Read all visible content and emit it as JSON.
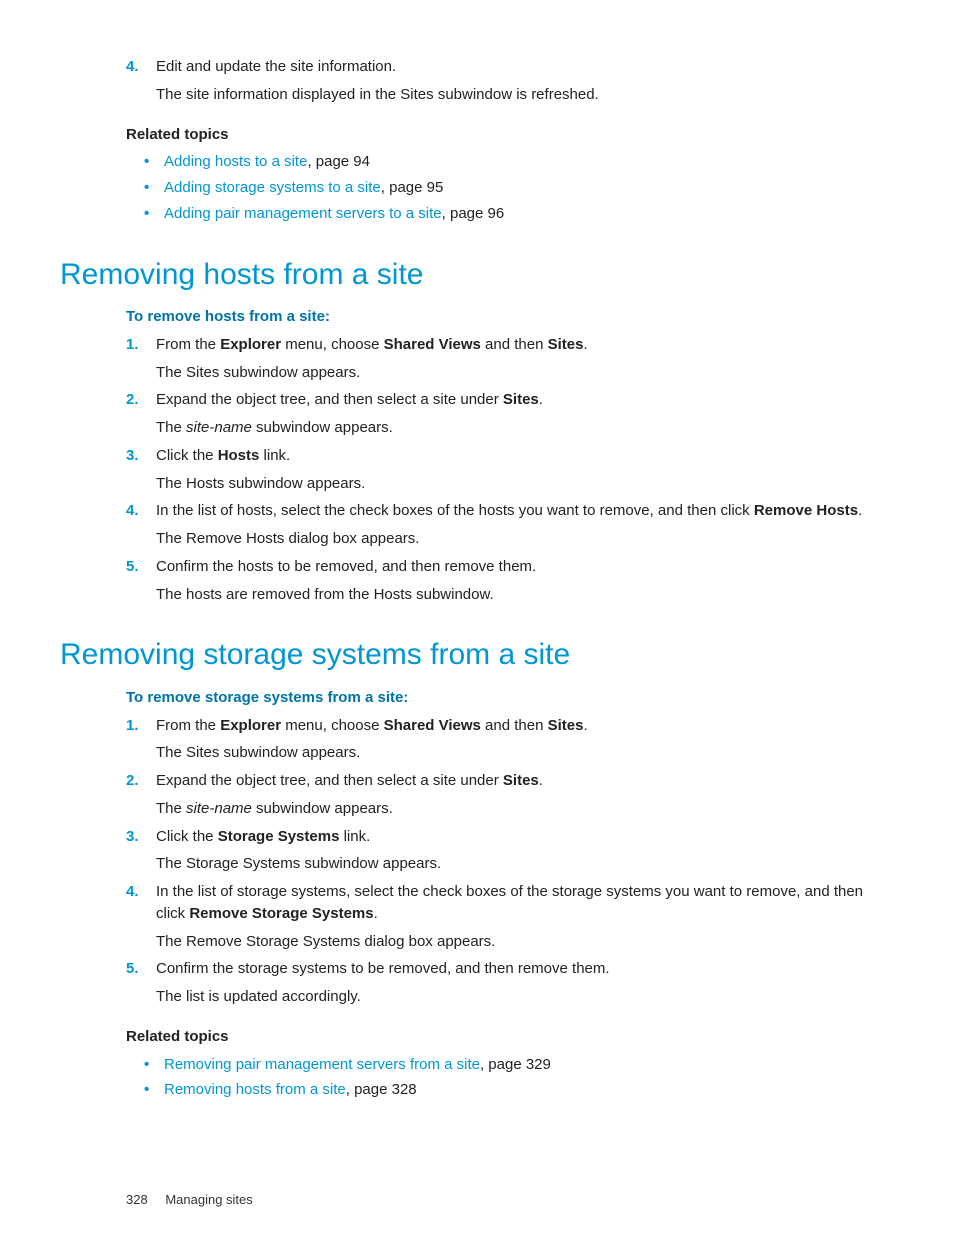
{
  "top": {
    "step4_num": "4.",
    "step4_a": "Edit and update the site information.",
    "step4_b": "The site information displayed in the Sites subwindow is refreshed.",
    "related_heading": "Related topics",
    "related": [
      {
        "link": "Adding hosts to a site",
        "suffix": ", page 94"
      },
      {
        "link": "Adding storage systems to a site",
        "suffix": ", page 95"
      },
      {
        "link": "Adding pair management servers to a site",
        "suffix": ", page 96"
      }
    ]
  },
  "sec1": {
    "heading": "Removing hosts from a site",
    "procedure": "To remove hosts from a site:",
    "steps": [
      {
        "num": "1.",
        "body": [
          {
            "t": "From the "
          },
          {
            "b": "Explorer"
          },
          {
            "t": " menu, choose "
          },
          {
            "b": "Shared Views"
          },
          {
            "t": " and then "
          },
          {
            "b": "Sites"
          },
          {
            "t": "."
          }
        ],
        "result": "The Sites subwindow appears."
      },
      {
        "num": "2.",
        "body": [
          {
            "t": "Expand the object tree, and then select a site under "
          },
          {
            "b": "Sites"
          },
          {
            "t": "."
          }
        ],
        "result_rich": [
          {
            "t": "The "
          },
          {
            "i": "site-name"
          },
          {
            "t": " subwindow appears."
          }
        ]
      },
      {
        "num": "3.",
        "body": [
          {
            "t": "Click the "
          },
          {
            "b": "Hosts"
          },
          {
            "t": " link."
          }
        ],
        "result": "The Hosts subwindow appears."
      },
      {
        "num": "4.",
        "body": [
          {
            "t": "In the list of hosts, select the check boxes of the hosts you want to remove, and then click "
          },
          {
            "b": "Remove Hosts"
          },
          {
            "t": "."
          }
        ],
        "result": "The Remove Hosts dialog box appears."
      },
      {
        "num": "5.",
        "body": [
          {
            "t": "Confirm the hosts to be removed, and then remove them."
          }
        ],
        "result": "The hosts are removed from the Hosts subwindow."
      }
    ]
  },
  "sec2": {
    "heading": "Removing storage systems from a site",
    "procedure": "To remove storage systems from a site:",
    "steps": [
      {
        "num": "1.",
        "body": [
          {
            "t": "From the "
          },
          {
            "b": "Explorer"
          },
          {
            "t": " menu, choose "
          },
          {
            "b": "Shared Views"
          },
          {
            "t": " and then "
          },
          {
            "b": "Sites"
          },
          {
            "t": "."
          }
        ],
        "result": "The Sites subwindow appears."
      },
      {
        "num": "2.",
        "body": [
          {
            "t": "Expand the object tree, and then select a site under "
          },
          {
            "b": "Sites"
          },
          {
            "t": "."
          }
        ],
        "result_rich": [
          {
            "t": "The "
          },
          {
            "i": "site-name"
          },
          {
            "t": " subwindow appears."
          }
        ]
      },
      {
        "num": "3.",
        "body": [
          {
            "t": "Click the "
          },
          {
            "b": "Storage Systems"
          },
          {
            "t": " link."
          }
        ],
        "result": "The Storage Systems subwindow appears."
      },
      {
        "num": "4.",
        "body": [
          {
            "t": "In the list of storage systems, select the check boxes of the storage systems you want to remove, and then click "
          },
          {
            "b": "Remove Storage Systems"
          },
          {
            "t": "."
          }
        ],
        "result": "The Remove Storage Systems dialog box appears."
      },
      {
        "num": "5.",
        "body": [
          {
            "t": "Confirm the storage systems to be removed, and then remove them."
          }
        ],
        "result": "The list is updated accordingly."
      }
    ],
    "related_heading": "Related topics",
    "related": [
      {
        "link": "Removing pair management servers from a site",
        "suffix": ", page 329"
      },
      {
        "link": "Removing hosts from a site",
        "suffix": ", page 328"
      }
    ]
  },
  "footer": {
    "page": "328",
    "section": "Managing sites"
  }
}
